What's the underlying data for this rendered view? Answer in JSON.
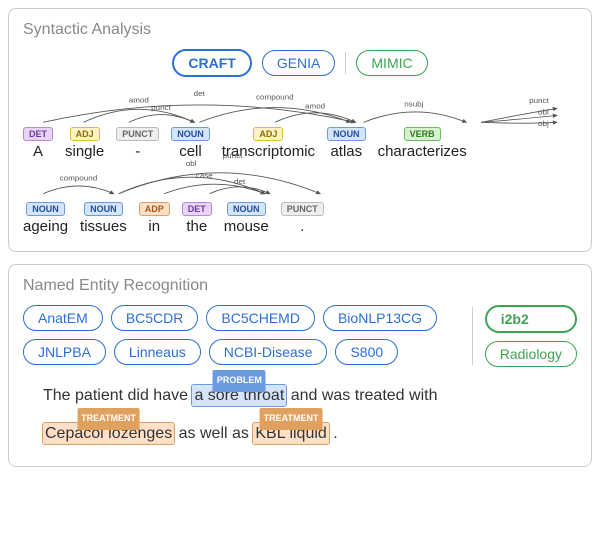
{
  "syntactic": {
    "title": "Syntactic Analysis",
    "corpora": [
      {
        "label": "CRAFT",
        "color": "blue",
        "active": true
      },
      {
        "label": "GENIA",
        "color": "blue",
        "active": false
      },
      {
        "label": "MIMIC",
        "color": "green",
        "active": false
      }
    ],
    "tokens_line1": [
      {
        "word": "A",
        "pos": "DET"
      },
      {
        "word": "single",
        "pos": "ADJ"
      },
      {
        "word": "-",
        "pos": "PUNCT"
      },
      {
        "word": "cell",
        "pos": "NOUN"
      },
      {
        "word": "transcriptomic",
        "pos": "ADJ"
      },
      {
        "word": "atlas",
        "pos": "NOUN"
      },
      {
        "word": "characterizes",
        "pos": "VERB"
      }
    ],
    "tokens_line2": [
      {
        "word": "ageing",
        "pos": "NOUN"
      },
      {
        "word": "tissues",
        "pos": "NOUN"
      },
      {
        "word": "in",
        "pos": "ADP"
      },
      {
        "word": "the",
        "pos": "DET"
      },
      {
        "word": "mouse",
        "pos": "NOUN"
      },
      {
        "word": ".",
        "pos": "PUNCT"
      }
    ],
    "arc_labels": {
      "det": "det",
      "amod": "amod",
      "punct": "punct",
      "compound": "compound",
      "nsubj": "nsubj",
      "obj": "obj",
      "obl": "obl",
      "case": "case"
    }
  },
  "ner": {
    "title": "Named Entity Recognition",
    "datasets_left": [
      "AnatEM",
      "BC5CDR",
      "BC5CHEMD",
      "BioNLP13CG",
      "JNLPBA",
      "Linneaus",
      "NCBI-Disease",
      "S800"
    ],
    "datasets_right": [
      {
        "label": "i2b2",
        "active": true
      },
      {
        "label": "Radiology",
        "active": false
      }
    ],
    "sentence_parts": {
      "t1": "The patient did have ",
      "e1": "a sore throat",
      "e1_label": "PROBLEM",
      "t2": " and was treated with ",
      "e2": "Cepacol lozenges",
      "e2_label": "TREATMENT",
      "t3": " as well as ",
      "e3": "KBL liquid",
      "e3_label": "TREATMENT",
      "t4": " ."
    }
  }
}
